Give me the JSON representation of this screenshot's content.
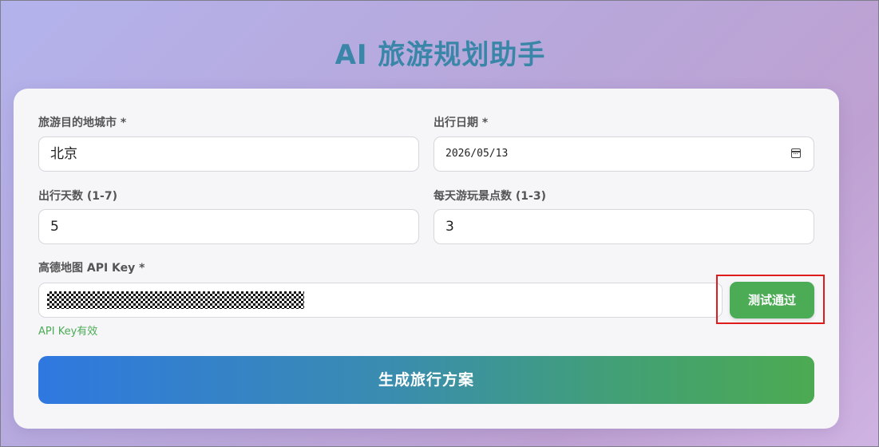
{
  "page": {
    "title": "AI 旅游规划助手"
  },
  "form": {
    "city": {
      "label": "旅游目的地城市 *",
      "value": "北京"
    },
    "date": {
      "label": "出行日期 *",
      "value": "2026/05/13",
      "icon": "calendar-icon"
    },
    "days": {
      "label": "出行天数 (1-7)",
      "value": "5"
    },
    "spots": {
      "label": "每天游玩景点数 (1-3)",
      "value": "3"
    },
    "api_key": {
      "label": "高德地图 API Key *",
      "masked": true
    },
    "test_button": {
      "label": "测试通过",
      "color": "#4cab55"
    },
    "api_status": {
      "text": "API Key有效",
      "color": "#4cab55"
    },
    "submit_button": {
      "label": "生成旅行方案"
    }
  },
  "highlight": {
    "target": "test-button",
    "color": "#e01b1b"
  },
  "colors": {
    "title": "#3a86a8",
    "submit_gradient_start": "#2f78e0",
    "submit_gradient_end": "#4caa52"
  }
}
